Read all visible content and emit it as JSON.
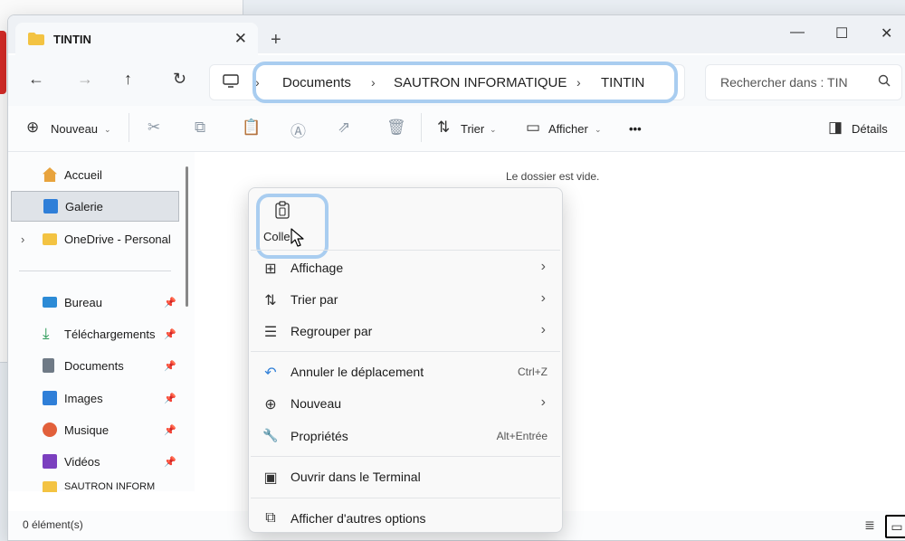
{
  "window": {
    "tab_title": "TINTIN",
    "tab_close": "✕",
    "new_tab": "+",
    "minimize": "—",
    "maximize": "☐",
    "close": "✕"
  },
  "navbar": {
    "back": "←",
    "forward": "→",
    "up": "↑",
    "refresh": "↻",
    "breadcrumb": [
      "Documents",
      "SAUTRON INFORMATIQUE",
      "TINTIN"
    ],
    "search_placeholder": "Rechercher dans : TIN"
  },
  "toolbar": {
    "new_label": "Nouveau",
    "sort_label": "Trier",
    "view_label": "Afficher",
    "more": "•••",
    "details_label": "Détails"
  },
  "sidebar": {
    "items": [
      {
        "label": "Accueil",
        "icon": "home-icon",
        "color": "#e8a33d"
      },
      {
        "label": "Galerie",
        "icon": "gallery-icon",
        "color": "#2f7fd8",
        "selected": true
      },
      {
        "label": "OneDrive - Personal",
        "icon": "folder-icon",
        "color": "#f3c342",
        "expandable": true
      }
    ],
    "pinned": [
      {
        "label": "Bureau",
        "icon": "desktop-icon",
        "color": "#2c8bd6"
      },
      {
        "label": "Téléchargements",
        "icon": "download-icon",
        "color": "#2a9a56"
      },
      {
        "label": "Documents",
        "icon": "documents-icon",
        "color": "#6f7a86"
      },
      {
        "label": "Images",
        "icon": "images-icon",
        "color": "#2f7fd8"
      },
      {
        "label": "Musique",
        "icon": "music-icon",
        "color": "#e2603b"
      },
      {
        "label": "Vidéos",
        "icon": "videos-icon",
        "color": "#7b3fbf"
      },
      {
        "label": "SAUTRON INFORM",
        "icon": "folder-icon",
        "color": "#f3c342"
      }
    ],
    "pin_glyph": "📌"
  },
  "content": {
    "empty_message": "Le dossier est vide."
  },
  "status": {
    "count": "0 élément(s)"
  },
  "context_menu": {
    "paste_label": "Coller",
    "items": [
      {
        "icon": "⊞",
        "label": "Affichage",
        "shortcut": "",
        "submenu": true
      },
      {
        "icon": "⇅",
        "label": "Trier par",
        "shortcut": "",
        "submenu": true
      },
      {
        "icon": "☰",
        "label": "Regrouper par",
        "shortcut": "",
        "submenu": true
      },
      {
        "icon": "↶",
        "label": "Annuler le déplacement",
        "shortcut": "Ctrl+Z",
        "submenu": false
      },
      {
        "icon": "⊕",
        "label": "Nouveau",
        "shortcut": "",
        "submenu": true
      },
      {
        "icon": "🔧",
        "label": "Propriétés",
        "shortcut": "Alt+Entrée",
        "submenu": false
      },
      {
        "icon": "▣",
        "label": "Ouvrir dans le Terminal",
        "shortcut": "",
        "submenu": false
      },
      {
        "icon": "⧉",
        "label": "Afficher d'autres options",
        "shortcut": "",
        "submenu": false
      }
    ]
  },
  "colors": {
    "highlight": "#a9cdf0",
    "folder": "#f3c342"
  }
}
